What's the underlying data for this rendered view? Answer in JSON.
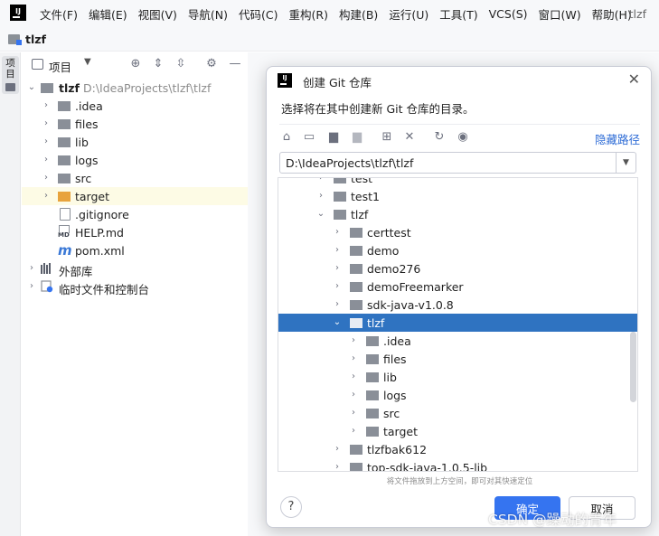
{
  "window": {
    "title": "tlzf",
    "logo": "IJ"
  },
  "menu": [
    "文件(F)",
    "编辑(E)",
    "视图(V)",
    "导航(N)",
    "代码(C)",
    "重构(R)",
    "构建(B)",
    "运行(U)",
    "工具(T)",
    "VCS(S)",
    "窗口(W)",
    "帮助(H)"
  ],
  "breadcrumb": {
    "project": "tlzf"
  },
  "stripe": {
    "project_tab": "项目"
  },
  "project_panel": {
    "title": "项目",
    "root": {
      "name": "tlzf",
      "path": "D:\\IdeaProjects\\tlzf\\tlzf"
    },
    "items": [
      {
        "name": ".idea",
        "type": "folder"
      },
      {
        "name": "files",
        "type": "folder"
      },
      {
        "name": "lib",
        "type": "folder"
      },
      {
        "name": "logs",
        "type": "folder"
      },
      {
        "name": "src",
        "type": "folder"
      },
      {
        "name": "target",
        "type": "folder-excluded"
      },
      {
        "name": ".gitignore",
        "type": "file"
      },
      {
        "name": "HELP.md",
        "type": "markdown"
      },
      {
        "name": "pom.xml",
        "type": "maven"
      }
    ],
    "external_libraries": "外部库",
    "scratches": "临时文件和控制台"
  },
  "dialog": {
    "title": "创建 Git 仓库",
    "description": "选择将在其中创建新 Git 仓库的目录。",
    "hide_path": "隐藏路径",
    "path_value": "D:\\IdeaProjects\\tlzf\\tlzf",
    "tree": {
      "partial_top": "test",
      "rows": [
        {
          "name": "test1",
          "depth": 1,
          "expanded": false
        },
        {
          "name": "tlzf",
          "depth": 1,
          "expanded": true
        },
        {
          "name": "certtest",
          "depth": 2,
          "expanded": false
        },
        {
          "name": "demo",
          "depth": 2,
          "expanded": false
        },
        {
          "name": "demo276",
          "depth": 2,
          "expanded": false
        },
        {
          "name": "demoFreemarker",
          "depth": 2,
          "expanded": false
        },
        {
          "name": "sdk-java-v1.0.8",
          "depth": 2,
          "expanded": false
        },
        {
          "name": "tlzf",
          "depth": 2,
          "expanded": true,
          "selected": true
        },
        {
          "name": ".idea",
          "depth": 3,
          "expanded": false
        },
        {
          "name": "files",
          "depth": 3,
          "expanded": false
        },
        {
          "name": "lib",
          "depth": 3,
          "expanded": false
        },
        {
          "name": "logs",
          "depth": 3,
          "expanded": false
        },
        {
          "name": "src",
          "depth": 3,
          "expanded": false
        },
        {
          "name": "target",
          "depth": 3,
          "expanded": false
        },
        {
          "name": "tlzfbak612",
          "depth": 2,
          "expanded": false
        },
        {
          "name": "top-sdk-java-1.0.5-lib",
          "depth": 2,
          "expanded": false
        }
      ]
    },
    "drag_hint": "将文件拖放到上方空间，即可对其快速定位",
    "help_label": "?",
    "ok_label": "确定",
    "cancel_label": "取消"
  },
  "watermark": "CSDN @躁动的青年",
  "colors": {
    "accent": "#3574f0",
    "selection": "#2f73c1",
    "highlight_row": "#fdfbe5",
    "link": "#2e6cd6"
  }
}
